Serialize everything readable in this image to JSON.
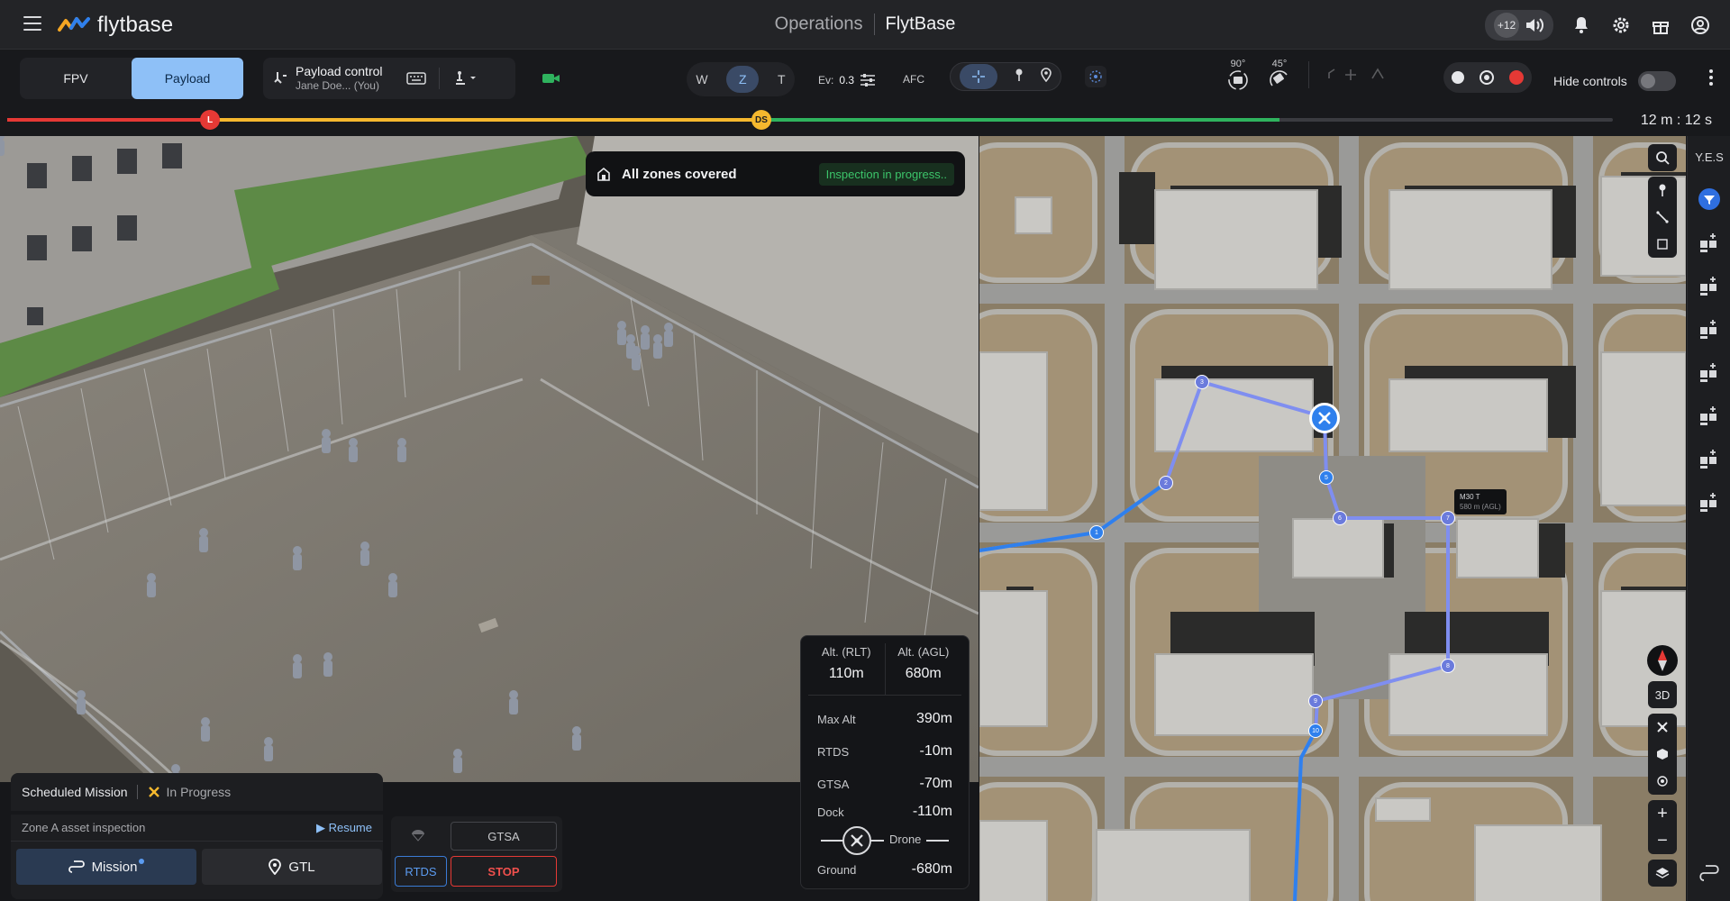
{
  "header": {
    "brand": "flytbase",
    "title_left": "Operations",
    "title_right": "FlytBase",
    "participants_badge": "+12",
    "icons": [
      "menu-icon",
      "speaker-icon",
      "bell-icon",
      "gear-icon",
      "gift-icon",
      "account-icon"
    ]
  },
  "toolbar": {
    "view_modes": [
      "FPV",
      "Payload"
    ],
    "active_view": "Payload",
    "payload_control": {
      "title": "Payload control",
      "subtitle": "Jane Doe... (You)"
    },
    "zoom_modes": [
      "W",
      "Z",
      "T"
    ],
    "active_zoom": "Z",
    "ev_label": "Ev:",
    "ev_value": "0.3",
    "afc_label": "AFC",
    "gimbal_pitch": "90°",
    "gimbal_yaw": "45°",
    "hide_controls_label": "Hide controls",
    "hide_controls_on": false
  },
  "timeline": {
    "marker_l": "L",
    "marker_ds": "DS",
    "elapsed": "12 m : 12 s",
    "colors": {
      "red": "#e53935",
      "yellow": "#f5b82e",
      "green": "#2fb35e"
    }
  },
  "banner": {
    "title": "All zones covered",
    "status": "Inspection in progress.."
  },
  "altitude": {
    "rlt_label": "Alt. (RLT)",
    "rlt_value": "110m",
    "agl_label": "Alt. (AGL)",
    "agl_value": "680m",
    "rows": [
      {
        "label": "Max Alt",
        "value": "390m"
      },
      {
        "label": "RTDS",
        "value": "-10m"
      },
      {
        "label": "GTSA",
        "value": "-70m"
      },
      {
        "label": "Dock",
        "value": "-110m"
      }
    ],
    "drone_label": "Drone",
    "ground_label": "Ground",
    "ground_value": "-680m"
  },
  "mission": {
    "title": "Scheduled Mission",
    "status": "In Progress",
    "zone": "Zone A asset inspection",
    "resume_label": "Resume",
    "mission_button": "Mission",
    "gtl_button": "GTL"
  },
  "actions": {
    "gtsa": "GTSA",
    "rtds": "RTDS",
    "stop": "STOP"
  },
  "map": {
    "drone_model": "M30 T",
    "drone_alt": "580 m (AGL)",
    "three_d_label": "3D",
    "waypoints": [
      "1",
      "2",
      "3",
      "4",
      "5",
      "6",
      "7",
      "8",
      "9",
      "10"
    ]
  },
  "rightbar": {
    "label": "Y.E.S"
  }
}
